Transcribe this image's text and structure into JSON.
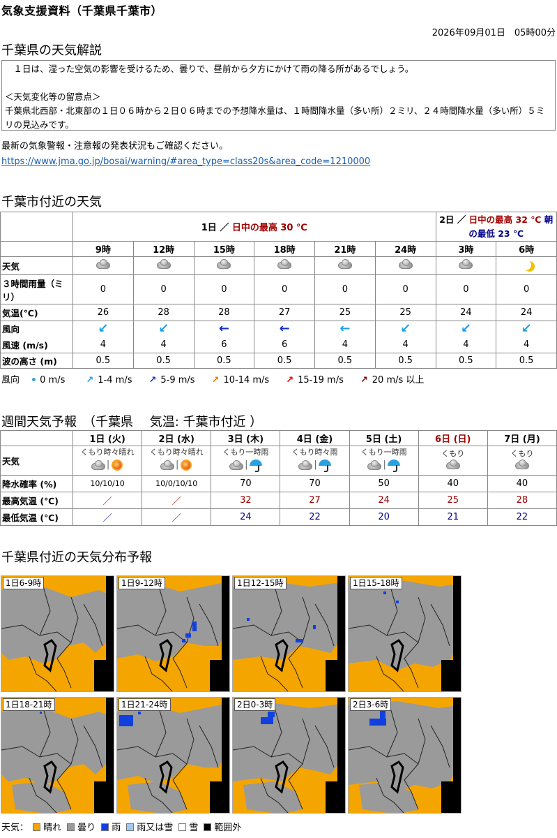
{
  "title": "気象支援資料（千葉県千葉市）",
  "issued": "2026年09月01日　05時00分",
  "commentary": {
    "heading": "千葉県の天気解説",
    "text": "　１日は、湿った空気の影響を受けるため、曇りで、昼前から夕方にかけて雨の降る所があるでしょう。\n\n＜天気変化等の留意点＞\n千葉県北西部・北東部の１日０６時から２日０６時までの予想降水量は、１時間降水量（多い所）２ミリ、２４時間降水量（多い所）５ミリの見込みです。"
  },
  "notice": {
    "text": "最新の気象警報・注意報の発表状況もご確認ください。",
    "link": "https://www.jma.go.jp/bosai/warning/#area_type=class20s&area_code=1210000"
  },
  "nearby": {
    "heading": "千葉市付近の天気",
    "day1": {
      "label": "1日 ／ ",
      "max_label": "日中の最高 30 ℃"
    },
    "day2": {
      "label": "2日 ／ ",
      "max_label": "日中の最高 32 ℃",
      "min_label": "朝の最低 23 ℃"
    },
    "row_labels": {
      "weather": "天気",
      "rain": "３時間雨量（ミリ）",
      "temp": "気温(℃)",
      "wind_dir": "風向",
      "wind_speed": "風速 (m/s)",
      "wave": "波の高さ (m)"
    },
    "hours": [
      "9時",
      "12時",
      "15時",
      "18時",
      "21時",
      "24時",
      "3時",
      "6時"
    ],
    "weather_icons": [
      "cloud-icon",
      "cloud-icon",
      "cloud-icon",
      "cloud-icon",
      "cloud-icon",
      "cloud-icon",
      "cloud-icon",
      "moon-icon"
    ],
    "rain": [
      "0",
      "0",
      "0",
      "0",
      "0",
      "0",
      "0",
      "0"
    ],
    "temp": [
      "26",
      "28",
      "28",
      "27",
      "25",
      "25",
      "24",
      "24"
    ],
    "wind_dir": [
      "↙",
      "↙",
      "←",
      "←",
      "←",
      "↙",
      "↙",
      "↙"
    ],
    "wind_color": [
      "#1ca0e8",
      "#1ca0e8",
      "#1030d0",
      "#1030d0",
      "#1ca0e8",
      "#1ca0e8",
      "#1ca0e8",
      "#1ca0e8"
    ],
    "wind_speed": [
      "4",
      "4",
      "6",
      "6",
      "4",
      "4",
      "4",
      "4"
    ],
    "wave": [
      "0.5",
      "0.5",
      "0.5",
      "0.5",
      "0.5",
      "0.5",
      "0.5",
      "0.5"
    ]
  },
  "wind_legend": {
    "label": "風向",
    "items": [
      {
        "glyph": "",
        "text": "0 m/s",
        "color": "#35a0d0"
      },
      {
        "glyph": "↗",
        "text": "1-4 m/s",
        "color": "#1ca0e8"
      },
      {
        "glyph": "↗",
        "text": "5-9 m/s",
        "color": "#1030d0"
      },
      {
        "glyph": "↗",
        "text": "10-14 m/s",
        "color": "#f07800"
      },
      {
        "glyph": "↗",
        "text": "15-19 m/s",
        "color": "#e00000"
      },
      {
        "glyph": "↗",
        "text": "20 m/s 以上",
        "color": "#800000"
      }
    ]
  },
  "weekly": {
    "heading": "週間天気予報　（千葉県　 気温: 千葉市付近 ）",
    "row_labels": {
      "weather": "天気",
      "pop": "降水確率 (%)",
      "max": "最高気温 (℃)",
      "min": "最低気温 (℃)"
    },
    "days": [
      {
        "label": "1日 (火)",
        "desc": "くもり時々晴れ",
        "icons": [
          "cloud-icon",
          "sun-icon"
        ],
        "pop": "10/10/10",
        "max": "／",
        "min": "／",
        "weekend": false
      },
      {
        "label": "2日 (水)",
        "desc": "くもり時々晴れ",
        "icons": [
          "cloud-icon",
          "sun-icon"
        ],
        "pop": "10/0/10/10",
        "max": "／",
        "min": "／",
        "weekend": false
      },
      {
        "label": "3日 (木)",
        "desc": "くもり一時雨",
        "icons": [
          "cloud-icon",
          "umbrella-icon"
        ],
        "pop": "70",
        "max": "32",
        "min": "24",
        "weekend": false
      },
      {
        "label": "4日 (金)",
        "desc": "くもり時々雨",
        "icons": [
          "cloud-icon",
          "umbrella-icon"
        ],
        "pop": "70",
        "max": "27",
        "min": "22",
        "weekend": false
      },
      {
        "label": "5日 (土)",
        "desc": "くもり一時雨",
        "icons": [
          "cloud-icon",
          "umbrella-icon"
        ],
        "pop": "50",
        "max": "24",
        "min": "20",
        "weekend": false
      },
      {
        "label": "6日 (日)",
        "desc": "くもり",
        "icons": [
          "cloud-icon"
        ],
        "pop": "40",
        "max": "25",
        "min": "21",
        "weekend": true
      },
      {
        "label": "7日 (月)",
        "desc": "くもり",
        "icons": [
          "cloud-icon"
        ],
        "pop": "40",
        "max": "28",
        "min": "22",
        "weekend": false
      }
    ]
  },
  "distribution": {
    "heading": "千葉県付近の天気分布予報",
    "maps": [
      {
        "label": "1日6-9時"
      },
      {
        "label": "1日9-12時"
      },
      {
        "label": "1日12-15時"
      },
      {
        "label": "1日15-18時"
      },
      {
        "label": "1日18-21時"
      },
      {
        "label": "1日21-24時"
      },
      {
        "label": "2日0-3時"
      },
      {
        "label": "2日3-6時"
      }
    ],
    "legend": {
      "prefix": "天気：",
      "items": [
        {
          "text": "晴れ",
          "color": "#f5a500"
        },
        {
          "text": "曇り",
          "color": "#9a9a9a"
        },
        {
          "text": "雨",
          "color": "#1040e0"
        },
        {
          "text": "雨又は雪",
          "color": "#a0c8f0"
        },
        {
          "text": "雪",
          "color": "#ffffff"
        },
        {
          "text": "範囲外",
          "color": "#000000"
        }
      ]
    }
  }
}
